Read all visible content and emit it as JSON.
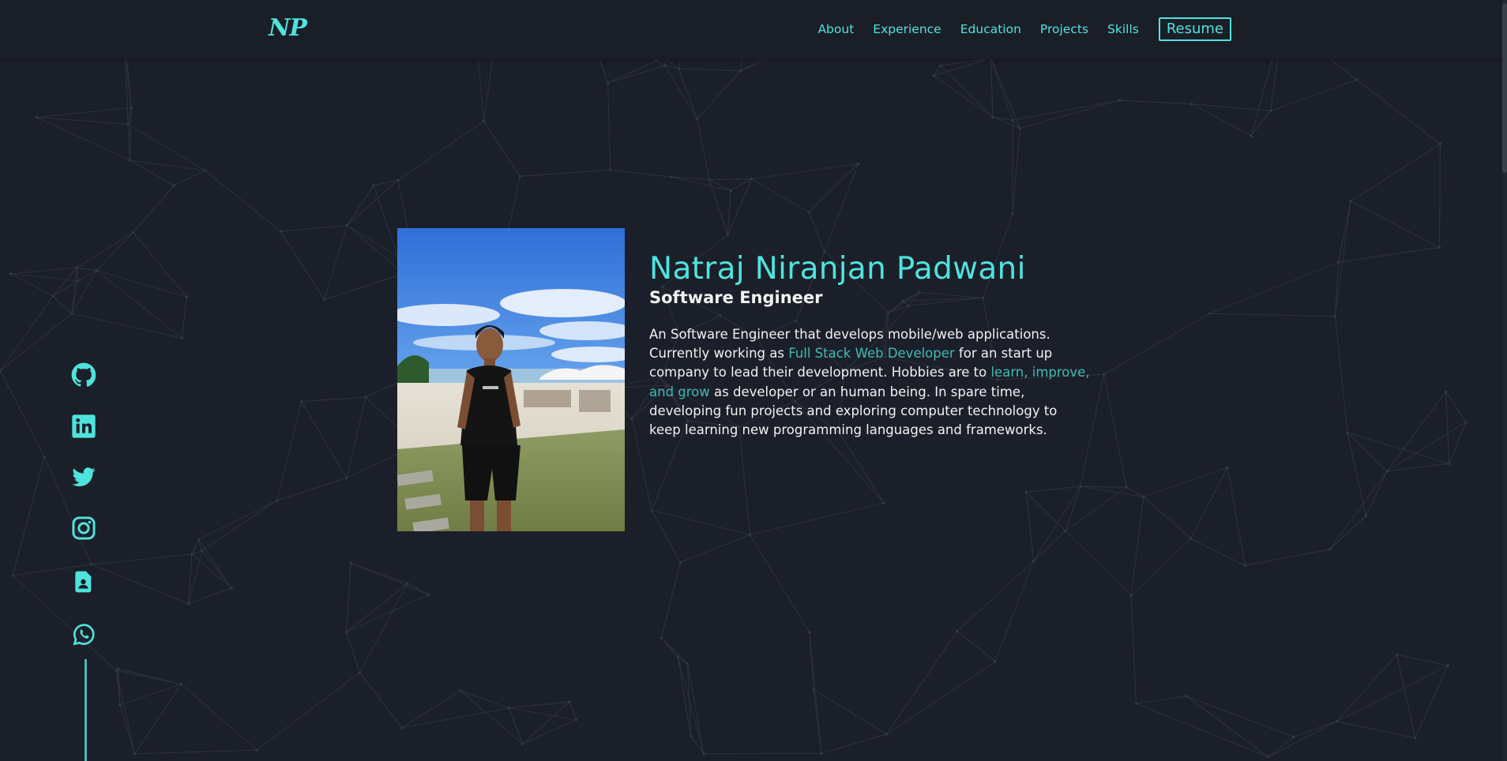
{
  "logo": "NP",
  "nav": {
    "links": [
      "About",
      "Experience",
      "Education",
      "Projects",
      "Skills"
    ],
    "resume_label": "Resume"
  },
  "social": [
    {
      "name": "github-icon"
    },
    {
      "name": "linkedin-icon"
    },
    {
      "name": "twitter-icon"
    },
    {
      "name": "instagram-icon"
    },
    {
      "name": "resume-document-icon"
    },
    {
      "name": "whatsapp-icon"
    }
  ],
  "hero": {
    "name": "Natraj Niranjan Padwani",
    "role": "Software Engineer",
    "bio": {
      "part1": "An Software Engineer that develops mobile/web applications. Currently working as ",
      "highlight1": "Full Stack Web Developer",
      "part2": " for an start up company to lead their development. Hobbies are to ",
      "highlight2": "learn, improve, and grow",
      "part3": " as developer or an human being. In spare time, developing fun projects and exploring computer technology to keep learning new programming languages and frameworks."
    }
  },
  "colors": {
    "accent": "#4fe3dd",
    "accent_muted": "#3fbcb4",
    "background": "#1b1f29",
    "navbar": "#1a1e27",
    "text": "#f2f2f2"
  }
}
